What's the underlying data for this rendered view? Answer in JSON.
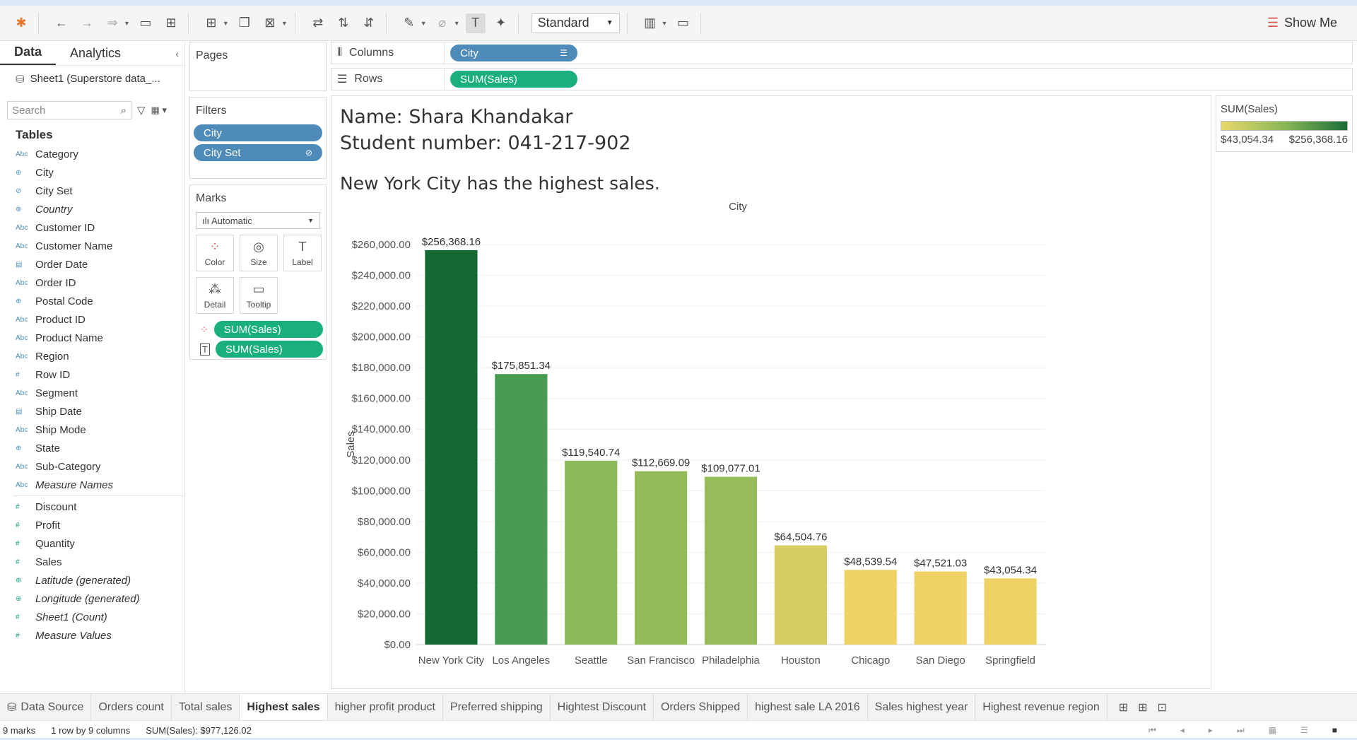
{
  "toolbar": {
    "view_mode": "Standard",
    "show_me_label": "Show Me"
  },
  "datapane": {
    "tab_data": "Data",
    "tab_analytics": "Analytics",
    "source": "Sheet1 (Superstore data_...",
    "search_placeholder": "Search",
    "tables_heading": "Tables",
    "dimensions": [
      {
        "icon": "Abc",
        "label": "Category"
      },
      {
        "icon": "⊕",
        "label": "City"
      },
      {
        "icon": "⊘",
        "label": "City Set"
      },
      {
        "icon": "⊕",
        "label": "Country"
      },
      {
        "icon": "Abc",
        "label": "Customer ID"
      },
      {
        "icon": "Abc",
        "label": "Customer Name"
      },
      {
        "icon": "▤",
        "label": "Order Date"
      },
      {
        "icon": "Abc",
        "label": "Order ID"
      },
      {
        "icon": "⊕",
        "label": "Postal Code"
      },
      {
        "icon": "Abc",
        "label": "Product ID"
      },
      {
        "icon": "Abc",
        "label": "Product Name"
      },
      {
        "icon": "Abc",
        "label": "Region"
      },
      {
        "icon": "#",
        "label": "Row ID"
      },
      {
        "icon": "Abc",
        "label": "Segment"
      },
      {
        "icon": "▤",
        "label": "Ship Date"
      },
      {
        "icon": "Abc",
        "label": "Ship Mode"
      },
      {
        "icon": "⊕",
        "label": "State"
      },
      {
        "icon": "Abc",
        "label": "Sub-Category"
      },
      {
        "icon": "Abc",
        "label": "Measure Names"
      }
    ],
    "measures": [
      {
        "icon": "#",
        "label": "Discount"
      },
      {
        "icon": "#",
        "label": "Profit"
      },
      {
        "icon": "#",
        "label": "Quantity"
      },
      {
        "icon": "#",
        "label": "Sales"
      },
      {
        "icon": "⊕",
        "label": "Latitude (generated)"
      },
      {
        "icon": "⊕",
        "label": "Longitude (generated)"
      },
      {
        "icon": "#",
        "label": "Sheet1 (Count)"
      },
      {
        "icon": "#",
        "label": "Measure Values"
      }
    ]
  },
  "shelves": {
    "pages_title": "Pages",
    "filters_title": "Filters",
    "filters": [
      "City",
      "City Set"
    ],
    "marks_title": "Marks",
    "marks_type": "Automatic",
    "marks_buttons": [
      "Color",
      "Size",
      "Label",
      "Detail",
      "Tooltip"
    ],
    "marks_pills": [
      "SUM(Sales)",
      "SUM(Sales)"
    ],
    "columns_label": "Columns",
    "columns_pill": "City",
    "rows_label": "Rows",
    "rows_pill": "SUM(Sales)"
  },
  "viz": {
    "name_line": "Name: Shara Khandakar",
    "student_line": "Student number: 041-217-902",
    "caption": "New York City has the highest sales."
  },
  "legend": {
    "title": "SUM(Sales)",
    "min": "$43,054.34",
    "max": "$256,368.16",
    "colors": [
      "#e9d86b",
      "#8ab858",
      "#1a6e38"
    ]
  },
  "chart_data": {
    "type": "bar",
    "title": "City",
    "xlabel": "City",
    "ylabel": "Sales",
    "categories": [
      "New York City",
      "Los Angeles",
      "Seattle",
      "San Francisco",
      "Philadelphia",
      "Houston",
      "Chicago",
      "San Diego",
      "Springfield"
    ],
    "values": [
      256368.16,
      175851.34,
      119540.74,
      112669.09,
      109077.01,
      64504.76,
      48539.54,
      47521.03,
      43054.34
    ],
    "value_labels": [
      "$256,368.16",
      "$175,851.34",
      "$119,540.74",
      "$112,669.09",
      "$109,077.01",
      "$64,504.76",
      "$48,539.54",
      "$47,521.03",
      "$43,054.34"
    ],
    "bar_colors": [
      "#156a34",
      "#4a9b52",
      "#8cb95b",
      "#93bb5a",
      "#96bc59",
      "#d5cc62",
      "#efd265",
      "#efd265",
      "#efd265"
    ],
    "ylim": [
      0,
      260000
    ],
    "yticks": [
      0,
      20000,
      40000,
      60000,
      80000,
      100000,
      120000,
      140000,
      160000,
      180000,
      200000,
      220000,
      240000,
      260000
    ],
    "ytick_labels": [
      "$0.00",
      "$20,000.00",
      "$40,000.00",
      "$60,000.00",
      "$80,000.00",
      "$100,000.00",
      "$120,000.00",
      "$140,000.00",
      "$160,000.00",
      "$180,000.00",
      "$200,000.00",
      "$220,000.00",
      "$240,000.00",
      "$260,000.00"
    ],
    "grid": true
  },
  "tabs": {
    "data_source": "Data Source",
    "sheets": [
      "Orders count",
      "Total sales",
      "Highest sales",
      "higher profit product",
      "Preferred shipping",
      "Hightest Discount",
      "Orders Shipped",
      "highest sale LA 2016",
      "Sales highest year",
      "Highest revenue region"
    ],
    "active": "Highest sales"
  },
  "status": {
    "marks": "9 marks",
    "dims": "1 row by 9 columns",
    "sum": "SUM(Sales): $977,126.02"
  }
}
